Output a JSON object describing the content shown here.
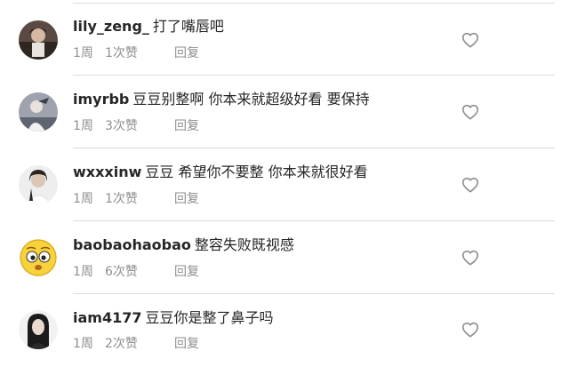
{
  "comments": [
    {
      "username": "lily_zeng_",
      "text": "打了嘴唇吧",
      "time": "1周",
      "likes": "1次赞",
      "reply": "回复",
      "avatar": "profile-photo"
    },
    {
      "username": "imyrbb",
      "text": "豆豆别整啊 你本来就超级好看 要保持",
      "time": "1周",
      "likes": "3次赞",
      "reply": "回复",
      "avatar": "profile-photo"
    },
    {
      "username": "wxxxinw",
      "text": "豆豆 希望你不要整 你本来就很好看",
      "time": "1周",
      "likes": "1次赞",
      "reply": "回复",
      "avatar": "profile-photo"
    },
    {
      "username": "baobaohaobao",
      "text": "整容失败既视感",
      "time": "1周",
      "likes": "6次赞",
      "reply": "回复",
      "avatar": "emoji-face"
    },
    {
      "username": "iam4177",
      "text": "豆豆你是整了鼻子吗",
      "time": "1周",
      "likes": "2次赞",
      "reply": "回复",
      "avatar": "profile-photo"
    }
  ],
  "colors": {
    "username": "#262626",
    "text": "#262626",
    "meta": "#8e8e8e",
    "divider": "#dbdbdb",
    "heart_outline": "#8e8e8e"
  },
  "icons": {
    "like": "heart-outline-icon"
  }
}
